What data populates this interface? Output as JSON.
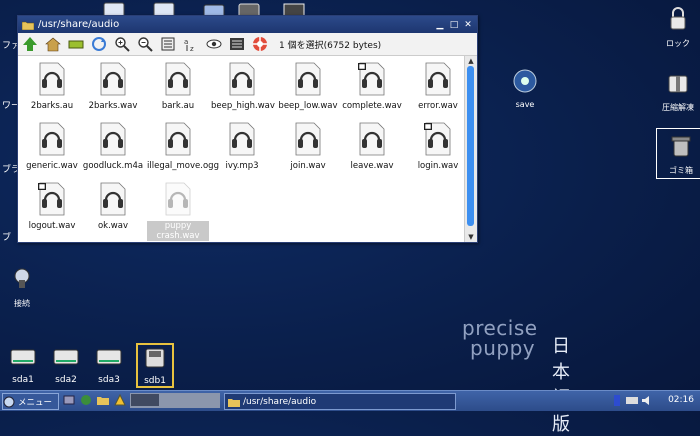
{
  "window": {
    "title": "/usr/share/audio",
    "selection_info": "1 個を選択(6752 bytes)",
    "files": [
      {
        "name": "2barks.au",
        "badge": false,
        "selected": false
      },
      {
        "name": "2barks.wav",
        "badge": false,
        "selected": false
      },
      {
        "name": "bark.au",
        "badge": false,
        "selected": false
      },
      {
        "name": "beep_high.wav",
        "badge": false,
        "selected": false
      },
      {
        "name": "beep_low.wav",
        "badge": false,
        "selected": false
      },
      {
        "name": "complete.wav",
        "badge": true,
        "selected": false
      },
      {
        "name": "error.wav",
        "badge": false,
        "selected": false
      },
      {
        "name": "generic.wav",
        "badge": false,
        "selected": false
      },
      {
        "name": "goodluck.m4a",
        "badge": false,
        "selected": false
      },
      {
        "name": "illegal_move.ogg",
        "badge": false,
        "selected": false
      },
      {
        "name": "ivy.mp3",
        "badge": false,
        "selected": false
      },
      {
        "name": "join.wav",
        "badge": false,
        "selected": false
      },
      {
        "name": "leave.wav",
        "badge": false,
        "selected": false
      },
      {
        "name": "login.wav",
        "badge": true,
        "selected": false
      },
      {
        "name": "logout.wav",
        "badge": true,
        "selected": false
      },
      {
        "name": "ok.wav",
        "badge": false,
        "selected": false
      },
      {
        "name": "puppy crash.wav",
        "badge": false,
        "selected": true
      }
    ]
  },
  "desktop": {
    "left_labels": [
      "ファ",
      "ワー",
      "ブラ",
      "ブ"
    ],
    "connect_label": "接続",
    "right_icons": [
      {
        "label": "ロック",
        "icon": "lock-icon"
      },
      {
        "label": "圧縮解凍",
        "icon": "archive-icon"
      },
      {
        "label": "ゴミ箱",
        "icon": "trash-icon"
      }
    ],
    "save_label": "save",
    "drives": [
      "sda1",
      "sda2",
      "sda3",
      "sdb1"
    ],
    "brand": {
      "line1": "precise",
      "line2": "puppy",
      "jp": "日本語版"
    }
  },
  "taskbar": {
    "menu_label": "メニュー",
    "task_label": "/usr/share/audio",
    "clock": "02:16"
  }
}
